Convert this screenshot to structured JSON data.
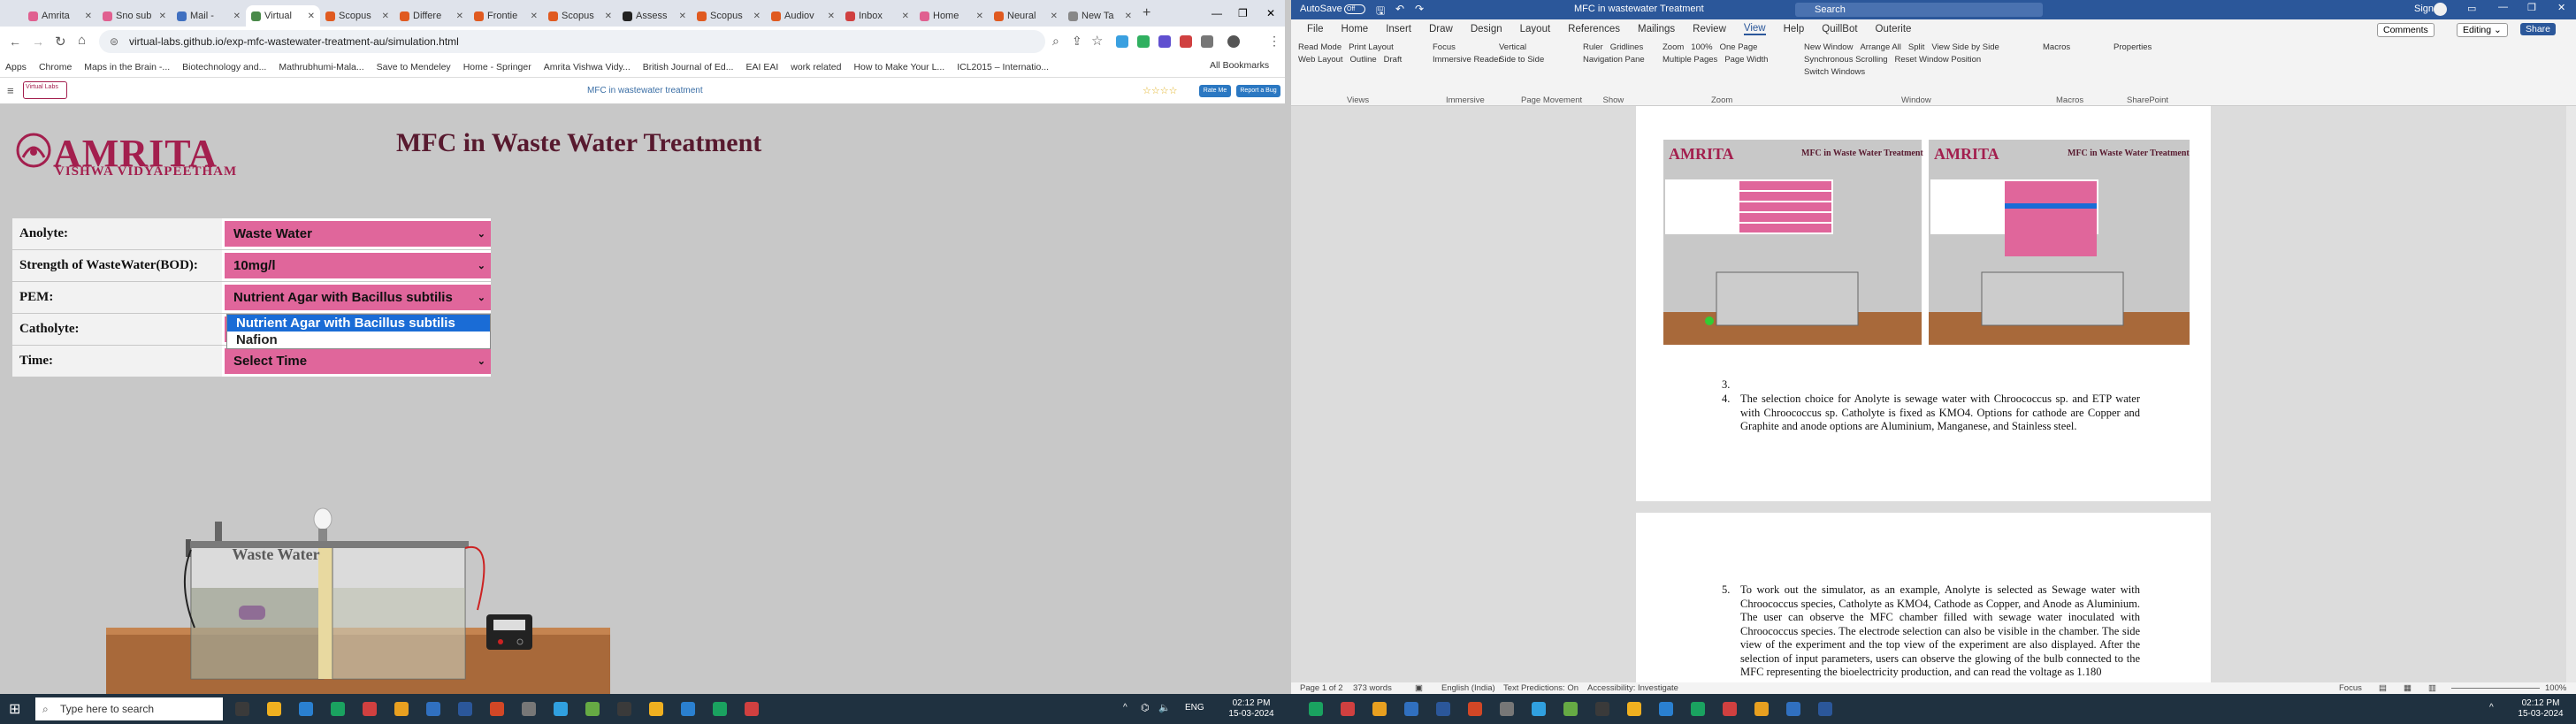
{
  "browser": {
    "tabs": [
      {
        "label": "Amrita",
        "color": "#e06090"
      },
      {
        "label": "Sno sub",
        "color": "#e06090"
      },
      {
        "label": "Mail -",
        "color": "#4070c0"
      },
      {
        "label": "Virtual",
        "color": "#4a8a4a",
        "active": true
      },
      {
        "label": "Scopus",
        "color": "#e05a20"
      },
      {
        "label": "Differe",
        "color": "#e05a20"
      },
      {
        "label": "Frontie",
        "color": "#e05a20"
      },
      {
        "label": "Scopus",
        "color": "#e05a20"
      },
      {
        "label": "Assess",
        "color": "#222222"
      },
      {
        "label": "Scopus",
        "color": "#e05a20"
      },
      {
        "label": "Audiov",
        "color": "#e05a20"
      },
      {
        "label": "Inbox",
        "color": "#d04040"
      },
      {
        "label": "Home",
        "color": "#e06090"
      },
      {
        "label": "Neural",
        "color": "#e05a20"
      },
      {
        "label": "New Ta",
        "color": "#888888"
      }
    ],
    "url": "virtual-labs.github.io/exp-mfc-wastewater-treatment-au/simulation.html",
    "bookmarks": [
      "Apps",
      "Chrome",
      "Maps in the Brain -...",
      "Biotechnology and...",
      "Mathrubhumi-Mala...",
      "Save to Mendeley",
      "Home - Springer",
      "Amrita Vishwa Vidy...",
      "British Journal of Ed...",
      "EAI EAI",
      "work related",
      "How to Make Your L...",
      "ICL2015 – Internatio..."
    ],
    "all_bookmarks": "All Bookmarks",
    "site_header": "MFC in wastewater treatment",
    "site_buttons": [
      "Rate Me",
      "Report a Bug"
    ]
  },
  "sim": {
    "logo_main": "AMRITA",
    "logo_sub": "VISHWA VIDYAPEETHAM",
    "title": "MFC in Waste Water Treatment",
    "rows": [
      {
        "label": "Anolyte:",
        "value": "Waste Water"
      },
      {
        "label": "Strength of WasteWater(BOD):",
        "value": "10mg/l"
      },
      {
        "label": "PEM:",
        "value": "Nutrient Agar with Bacillus subtilis"
      },
      {
        "label": "Catholyte:",
        "value": ""
      },
      {
        "label": "Time:",
        "value": "Select Time"
      }
    ],
    "dropdown_options": [
      "Nutrient Agar with Bacillus subtilis",
      "Nafion"
    ],
    "tank_label": "Waste Water"
  },
  "word": {
    "autosave": "AutoSave",
    "doc_title": "MFC in wastewater Treatment",
    "search": "Search",
    "user": "Sign in",
    "menu": [
      "File",
      "Home",
      "Insert",
      "Draw",
      "Design",
      "Layout",
      "References",
      "Mailings",
      "Review",
      "View",
      "Help",
      "QuillBot",
      "Outerite"
    ],
    "active_menu": "View",
    "comments": "Comments",
    "editing": "Editing",
    "share": "Share",
    "ribbon_groups": [
      {
        "label": "Views",
        "items": [
          "Read Mode",
          "Print Layout",
          "Web Layout",
          "Outline",
          "Draft"
        ]
      },
      {
        "label": "Immersive",
        "items": [
          "Focus",
          "Immersive Reader"
        ]
      },
      {
        "label": "Page Movement",
        "items": [
          "Vertical",
          "Side to Side"
        ]
      },
      {
        "label": "Show",
        "items": [
          "Ruler",
          "Gridlines",
          "Navigation Pane"
        ]
      },
      {
        "label": "Zoom",
        "items": [
          "Zoom",
          "100%",
          "One Page",
          "Multiple Pages",
          "Page Width"
        ]
      },
      {
        "label": "Window",
        "items": [
          "New Window",
          "Arrange All",
          "Split",
          "View Side by Side",
          "Synchronous Scrolling",
          "Reset Window Position",
          "Switch Windows"
        ]
      },
      {
        "label": "Macros",
        "items": [
          "Macros"
        ]
      },
      {
        "label": "SharePoint",
        "items": [
          "Properties"
        ]
      }
    ],
    "list_item_3": "3.",
    "list_item_4_num": "4.",
    "list_item_4": "The selection choice for Anolyte is sewage water with Chroococcus sp. and ETP water with Chroococcus sp. Catholyte is fixed as KMO4. Options for cathode are Copper and Graphite and anode options are Aluminium, Manganese, and Stainless steel.",
    "list_item_5_num": "5.",
    "list_item_5": "To work out the simulator, as an example, Anolyte is selected as Sewage water with Chroococcus species, Catholyte as KMO4, Cathode as Copper, and Anode as Aluminium. The user can observe the MFC chamber filled with sewage water inoculated with Chroococcus species. The electrode selection can also be visible in the chamber. The side view of the experiment and the top view of the experiment are also displayed. After the selection of input parameters, users can observe the glowing of the bulb connected to the MFC representing the bioelectricity production, and can read the voltage as 1.180",
    "status": {
      "page": "Page 1 of 2",
      "words": "373 words",
      "lang": "English (India)",
      "predictions": "Text Predictions: On",
      "access": "Accessibility: Investigate",
      "focus": "Focus",
      "zoom": "100%"
    }
  },
  "taskbar": {
    "search": "Type here to search",
    "lang": "ENG",
    "time": "02:12 PM",
    "date": "15-03-2024"
  }
}
